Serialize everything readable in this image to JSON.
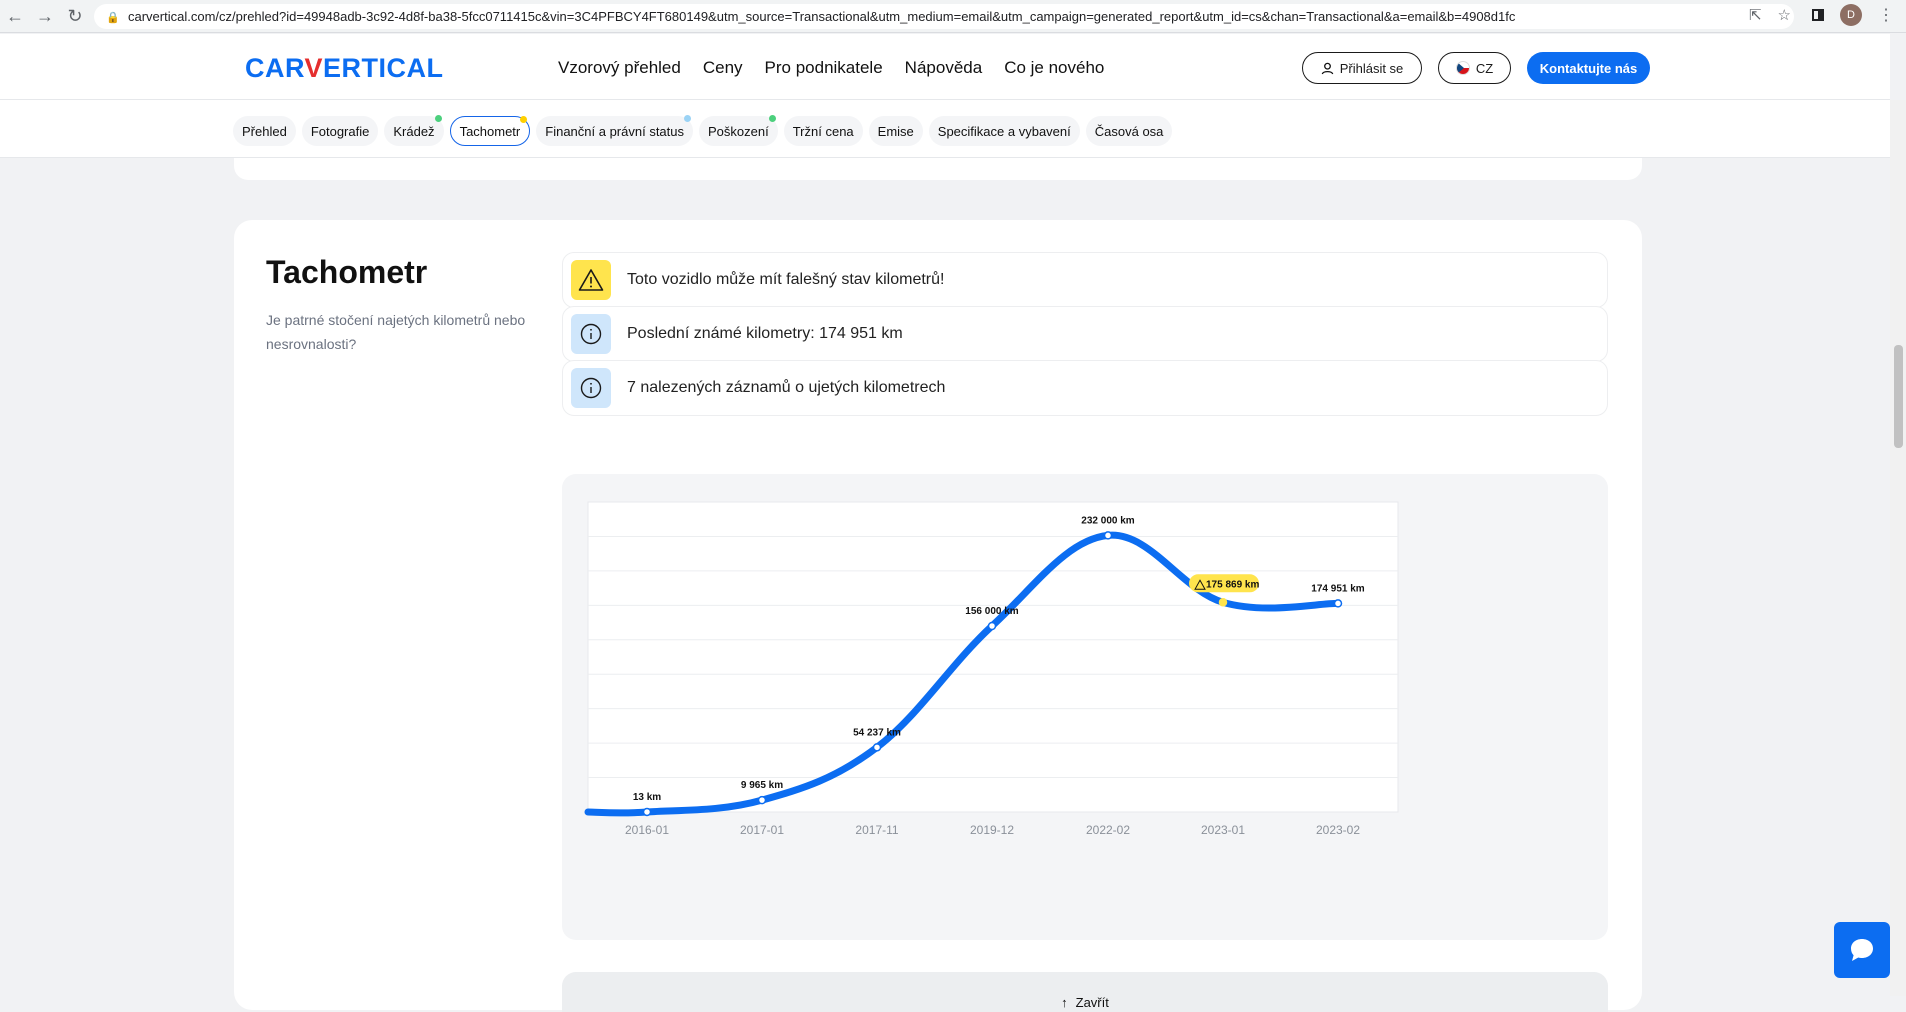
{
  "browser": {
    "url": "carvertical.com/cz/prehled?id=49948adb-3c92-4d8f-ba38-5fcc0711415c&vin=3C4PFBCY4FT680149&utm_source=Transactional&utm_medium=email&utm_campaign=generated_report&utm_id=cs&chan=Transactional&a=email&b=4908d1fc",
    "avatar_letter": "D"
  },
  "header": {
    "logo_main": "CAR",
    "logo_v": "V",
    "logo_rest": "ERTICAL",
    "nav": [
      "Vzorový přehled",
      "Ceny",
      "Pro podnikatele",
      "Nápověda",
      "Co je nového"
    ],
    "login_label": "Přihlásit se",
    "lang_label": "CZ",
    "contact_label": "Kontaktujte nás"
  },
  "tabs": [
    {
      "label": "Přehled",
      "dot": ""
    },
    {
      "label": "Fotografie",
      "dot": ""
    },
    {
      "label": "Krádež",
      "dot": "#4cd07d"
    },
    {
      "label": "Tachometr",
      "dot": "#ffd000",
      "active": true
    },
    {
      "label": "Finanční a právní status",
      "dot": "#9bd3f5"
    },
    {
      "label": "Poškození",
      "dot": "#4cd07d"
    },
    {
      "label": "Tržní cena",
      "dot": ""
    },
    {
      "label": "Emise",
      "dot": ""
    },
    {
      "label": "Specifikace a vybavení",
      "dot": ""
    },
    {
      "label": "Časová osa",
      "dot": ""
    }
  ],
  "section": {
    "title": "Tachometr",
    "subtitle": "Je patrné stočení najetých kilometrů nebo nesrovnalosti?",
    "alerts": [
      {
        "type": "warning",
        "text": "Toto vozidlo může mít falešný stav kilometrů!"
      },
      {
        "type": "info",
        "text": "Poslední známé kilometry: 174 951 km"
      },
      {
        "type": "info",
        "text": "7 nalezených záznamů o ujetých kilometrech"
      }
    ],
    "close_label": "Zavřít"
  },
  "chart_data": {
    "type": "line",
    "categories": [
      "2016-01",
      "2017-01",
      "2017-11",
      "2019-12",
      "2022-02",
      "2023-01",
      "2023-02"
    ],
    "values": [
      13,
      9965,
      54237,
      156000,
      232000,
      175869,
      174951
    ],
    "point_labels": [
      "13 km",
      "9 965 km",
      "54 237 km",
      "156 000 km",
      "232 000 km",
      "175 869 km",
      "174 951 km"
    ],
    "flagged_index": 5,
    "ylim": [
      0,
      260000
    ],
    "grid": true,
    "line_color": "#0c6df1",
    "warning_color": "#ffe44d"
  }
}
